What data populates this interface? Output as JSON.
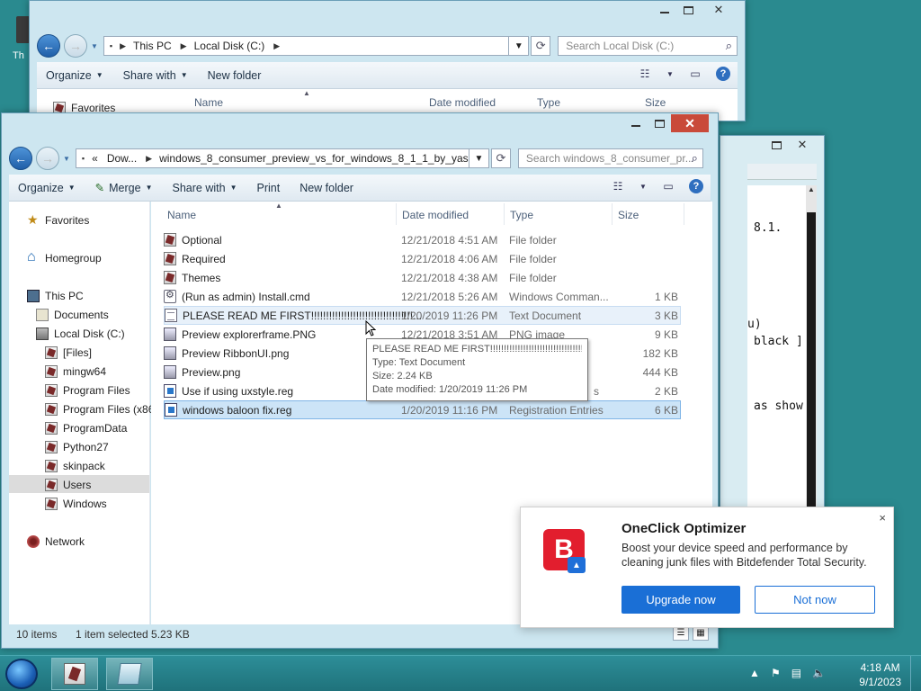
{
  "desktop": {
    "icon_label": "Th"
  },
  "back_window": {
    "address": [
      "This PC",
      "Local Disk (C:)"
    ],
    "search_placeholder": "Search Local Disk (C:)",
    "toolbar": [
      "Organize",
      "Share with",
      "New folder"
    ],
    "nav_first": "Favorites",
    "columns": [
      "Name",
      "Date modified",
      "Type",
      "Size"
    ]
  },
  "terminal": {
    "lines": [
      "8.1.",
      "u)",
      "black ]",
      "as show"
    ]
  },
  "front_window": {
    "address_prefix": "«",
    "address": [
      "Dow...",
      "windows_8_consumer_preview_vs_for_windows_8_1_1_by_yas..."
    ],
    "search_placeholder": "Search windows_8_consumer_pr...",
    "toolbar": {
      "organize": "Organize",
      "merge": "Merge",
      "share": "Share with",
      "print": "Print",
      "new_folder": "New folder"
    },
    "nav": {
      "favorites": "Favorites",
      "homegroup": "Homegroup",
      "this_pc": "This PC",
      "documents": "Documents",
      "local_disk": "Local Disk (C:)",
      "files": "[Files]",
      "mingw64": "mingw64",
      "program_files": "Program Files",
      "program_files_x86": "Program Files (x86)",
      "programdata": "ProgramData",
      "python27": "Python27",
      "skinpack": "skinpack",
      "users": "Users",
      "windows": "Windows",
      "network": "Network"
    },
    "columns": {
      "name": "Name",
      "date": "Date modified",
      "type": "Type",
      "size": "Size"
    },
    "files": [
      {
        "name": "Optional",
        "date": "12/21/2018 4:51 AM",
        "type": "File folder",
        "size": ""
      },
      {
        "name": "Required",
        "date": "12/21/2018 4:06 AM",
        "type": "File folder",
        "size": ""
      },
      {
        "name": "Themes",
        "date": "12/21/2018 4:38 AM",
        "type": "File folder",
        "size": ""
      },
      {
        "name": "(Run as admin) Install.cmd",
        "date": "12/21/2018 5:26 AM",
        "type": "Windows Comman...",
        "size": "1 KB"
      },
      {
        "name": "PLEASE READ ME FIRST!!!!!!!!!!!!!!!!!!!!!!!!!!!!!!!!!!...",
        "date": "1/20/2019 11:26 PM",
        "type": "Text Document",
        "size": "3 KB"
      },
      {
        "name": "Preview explorerframe.PNG",
        "date": "12/21/2018 3:51 AM",
        "type": "PNG image",
        "size": "9 KB"
      },
      {
        "name": "Preview RibbonUI.png",
        "date": "",
        "type": "",
        "size": "182 KB"
      },
      {
        "name": "Preview.png",
        "date": "",
        "type": "",
        "size": "444 KB"
      },
      {
        "name": "Use if using uxstyle.reg",
        "date": "",
        "type": "s",
        "size": "2 KB"
      },
      {
        "name": "windows baloon fix.reg",
        "date": "1/20/2019 11:16 PM",
        "type": "Registration Entries",
        "size": "6 KB"
      }
    ],
    "tooltip": {
      "title": "PLEASE READ ME FIRST!!!!!!!!!!!!!!!!!!!!!!!!!!!!!!!!!!!!!!!!!.txt",
      "type": "Type: Text Document",
      "size": "Size: 2.24 KB",
      "date": "Date modified: 1/20/2019 11:26 PM"
    },
    "status": {
      "count": "10 items",
      "selection": "1 item selected  5.23 KB"
    }
  },
  "toast": {
    "title": "OneClick Optimizer",
    "message": "Boost your device speed and performance by cleaning junk files with Bitdefender Total Security.",
    "logo_letter": "B",
    "upgrade": "Upgrade now",
    "dismiss": "Not now",
    "close": "×"
  },
  "taskbar": {
    "time": "4:18 AM",
    "date": "9/1/2023"
  },
  "colors": {
    "accent": "#1a6fd6",
    "brand_red": "#e21e2e",
    "taskbar": "#2a8a8f"
  }
}
